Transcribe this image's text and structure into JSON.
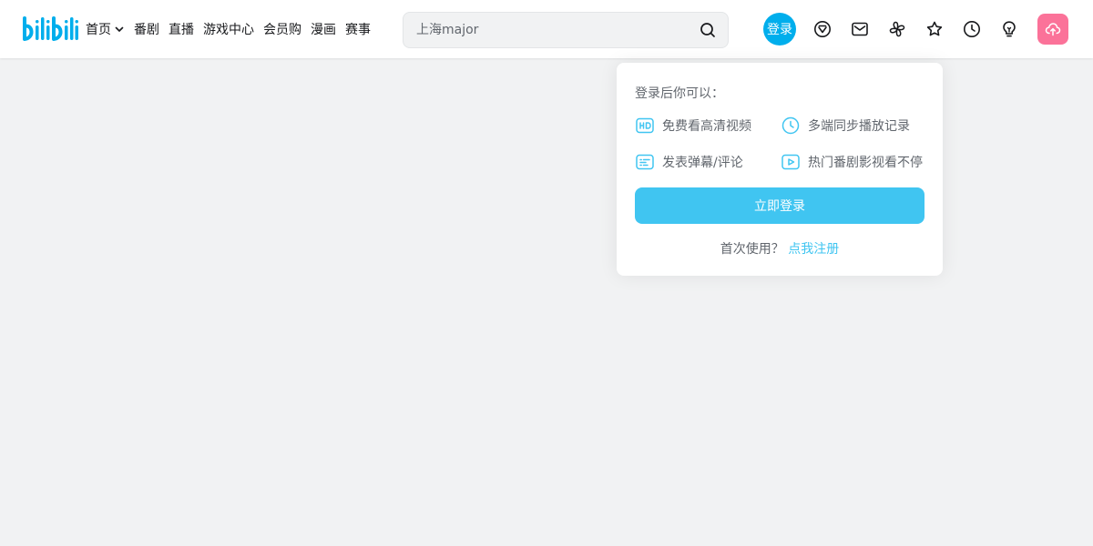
{
  "header": {
    "logo_text": "bilibili",
    "nav": [
      {
        "label": "首页",
        "has_dropdown": true
      },
      {
        "label": "番剧"
      },
      {
        "label": "直播"
      },
      {
        "label": "游戏中心"
      },
      {
        "label": "会员购"
      },
      {
        "label": "漫画"
      },
      {
        "label": "赛事"
      }
    ],
    "search": {
      "placeholder": "上海major"
    },
    "login_label": "登录",
    "icons": [
      "vip-icon",
      "message-icon",
      "dynamic-icon",
      "favorite-icon",
      "history-icon",
      "creation-icon",
      "upload-icon"
    ]
  },
  "login_popover": {
    "title": "登录后你可以：",
    "benefits": [
      {
        "label": "免费看高清视频",
        "icon": "hd-icon"
      },
      {
        "label": "多端同步播放记录",
        "icon": "clock-icon"
      },
      {
        "label": "发表弹幕/评论",
        "icon": "danmaku-icon"
      },
      {
        "label": "热门番剧影视看不停",
        "icon": "play-icon"
      }
    ],
    "login_button": "立即登录",
    "register_prompt": "首次使用？",
    "register_link": "点我注册"
  },
  "colors": {
    "brand_blue": "#00aeec",
    "light_blue": "#40c5f1",
    "pink": "#fb7299",
    "page_bg": "#f1f2f3"
  }
}
